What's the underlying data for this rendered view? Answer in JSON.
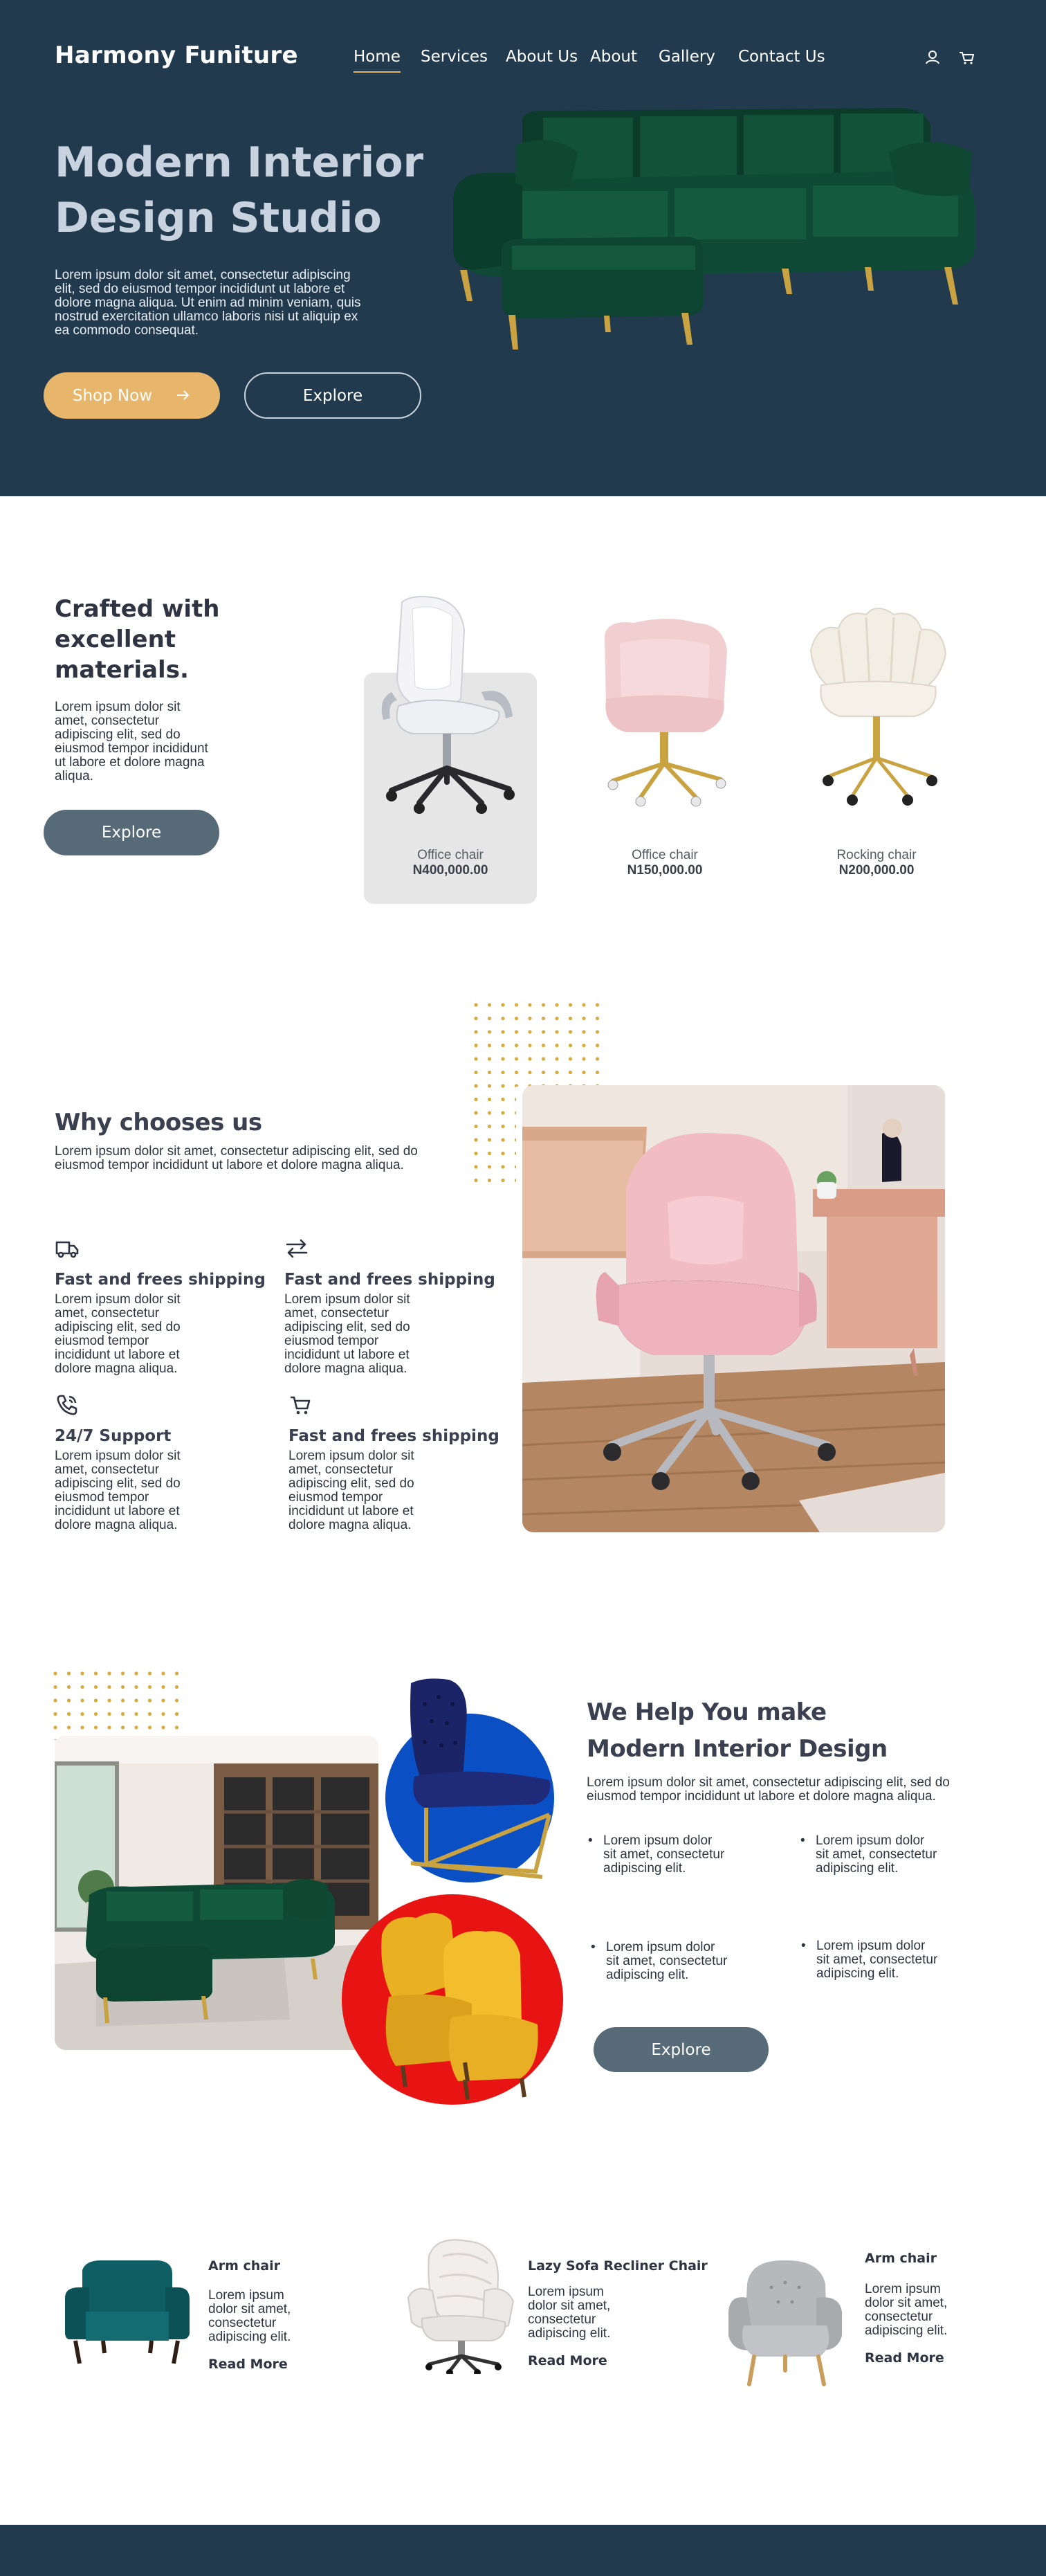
{
  "header": {
    "brand": "Harmony Funiture",
    "nav": [
      "Home",
      "Services",
      "About Us",
      "About",
      "Gallery",
      "Contact Us"
    ],
    "icons": [
      "user-icon",
      "cart-icon"
    ]
  },
  "hero": {
    "title": "Modern Interior Design Studio",
    "text": "Lorem ipsum dolor sit amet, consectetur adipiscing elit, sed do eiusmod tempor incididunt ut labore et dolore magna aliqua. Ut enim ad minim veniam, quis nostrud exercitation ullamco laboris nisi ut aliquip ex ea commodo consequat.",
    "shop_label": "Shop Now",
    "explore_label": "Explore"
  },
  "crafted": {
    "title": "Crafted with excellent materials.",
    "text": "Lorem ipsum dolor sit amet, consectetur adipiscing elit, sed do eiusmod tempor incididunt ut labore et dolore magna aliqua.",
    "button": "Explore",
    "products": [
      {
        "name": "Office chair",
        "price": "N400,000.00"
      },
      {
        "name": "Office chair",
        "price": "N150,000.00"
      },
      {
        "name": "Rocking chair",
        "price": "N200,000.00"
      }
    ]
  },
  "why": {
    "title": "Why chooses us",
    "text": "Lorem ipsum dolor sit amet, consectetur adipiscing elit, sed do eiusmod tempor incididunt ut labore et dolore magna aliqua.",
    "features": [
      {
        "icon": "truck-icon",
        "title": "Fast and frees shipping",
        "text": "Lorem ipsum dolor sit amet, consectetur adipiscing elit, sed do eiusmod tempor incididunt ut labore et dolore magna aliqua."
      },
      {
        "icon": "exchange-arrows-icon",
        "title": "Fast and frees shipping",
        "text": "Lorem ipsum dolor sit amet, consectetur adipiscing elit, sed do eiusmod tempor incididunt ut labore et dolore magna aliqua."
      },
      {
        "icon": "phone-icon",
        "title": "24/7 Support",
        "text": "Lorem ipsum dolor sit amet, consectetur adipiscing elit, sed do eiusmod tempor incididunt ut labore et dolore magna aliqua."
      },
      {
        "icon": "cart-icon",
        "title": "Fast and frees shipping",
        "text": "Lorem ipsum dolor sit amet, consectetur adipiscing elit, sed do eiusmod tempor incididunt ut labore et dolore magna aliqua."
      }
    ]
  },
  "help": {
    "title_line1": "We Help You make",
    "title_line2": "Modern Interior Design",
    "text": "Lorem ipsum dolor sit amet, consectetur adipiscing elit, sed do eiusmod tempor incididunt ut labore et dolore magna aliqua.",
    "bullets": [
      "Lorem ipsum dolor sit amet, consectetur adipiscing elit.",
      "Lorem ipsum dolor sit amet, consectetur adipiscing elit.",
      "Lorem ipsum dolor sit amet, consectetur adipiscing elit.",
      "Lorem ipsum dolor sit amet, consectetur adipiscing elit."
    ],
    "button": "Explore"
  },
  "product_row": [
    {
      "title": "Arm chair",
      "text": "Lorem ipsum dolor sit amet, consectetur adipiscing elit.",
      "link": "Read More"
    },
    {
      "title": "Lazy Sofa Recliner Chair",
      "text": "Lorem ipsum dolor sit amet, consectetur adipiscing elit.",
      "link": "Read More"
    },
    {
      "title": "Arm chair",
      "text": "Lorem ipsum dolor sit amet, consectetur adipiscing elit.",
      "link": "Read More"
    }
  ],
  "colors": {
    "navy": "#223a4d",
    "gold": "#e8b66b",
    "slate_button": "#566a78",
    "green_velvet": "#0f4a36",
    "pink": "#f2c7c9",
    "blue_circle": "#0a4fc4",
    "red_circle": "#e81313"
  }
}
